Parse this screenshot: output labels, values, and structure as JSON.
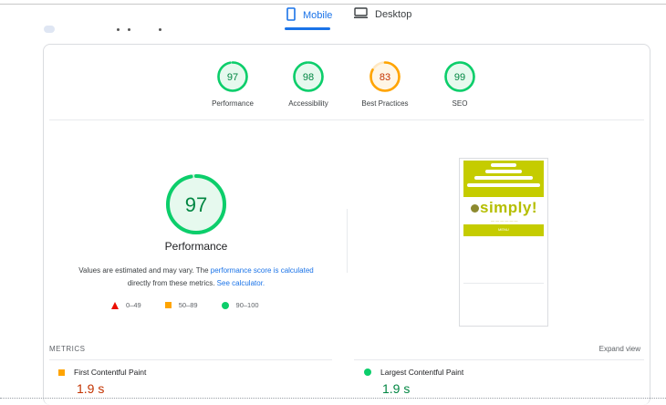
{
  "tabs": [
    {
      "label": "Mobile",
      "icon": "smartphone-icon",
      "active": true
    },
    {
      "label": "Desktop",
      "icon": "monitor-icon",
      "active": false
    }
  ],
  "colors": {
    "pass": "#0cce6b",
    "pass_text": "#018642",
    "average": "#ffa400",
    "average_text": "#c33300",
    "fail": "#eb0f00",
    "accent": "#1a73e8"
  },
  "scores": [
    {
      "label": "Performance",
      "value": "97",
      "rating": "pass"
    },
    {
      "label": "Accessibility",
      "value": "98",
      "rating": "pass"
    },
    {
      "label": "Best Practices",
      "value": "83",
      "rating": "average"
    },
    {
      "label": "SEO",
      "value": "99",
      "rating": "pass"
    }
  ],
  "main": {
    "score": "97",
    "title": "Performance",
    "note_prefix": "Values are estimated and may vary. The ",
    "note_link1": "performance score is calculated",
    "note_middle": " directly from these metrics. ",
    "note_link2": "See calculator."
  },
  "legend": [
    {
      "range": "0–49",
      "shape": "triangle",
      "color": "#eb0f00"
    },
    {
      "range": "50–89",
      "shape": "square",
      "color": "#ffa400"
    },
    {
      "range": "90–100",
      "shape": "circle",
      "color": "#0cce6b"
    }
  ],
  "screenshot": {
    "logo_text": "simply!",
    "menu_label": "MENU"
  },
  "metrics": {
    "heading": "METRICS",
    "expand_label": "Expand view",
    "items": [
      {
        "name": "First Contentful Paint",
        "value": "1.9 s",
        "rating": "average"
      },
      {
        "name": "Largest Contentful Paint",
        "value": "1.9 s",
        "rating": "pass"
      }
    ]
  }
}
